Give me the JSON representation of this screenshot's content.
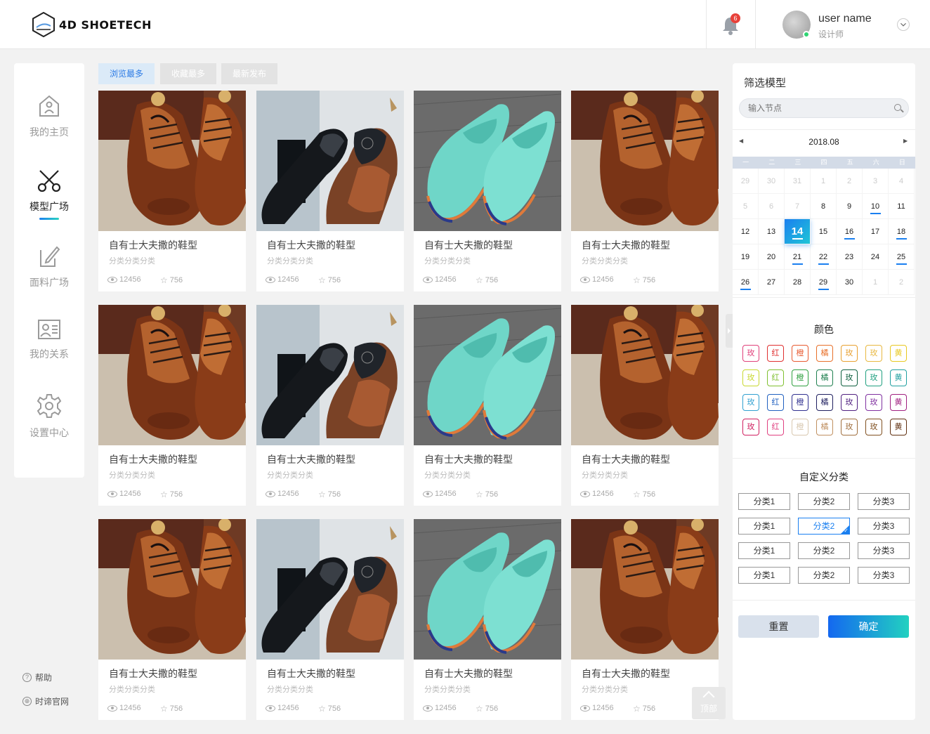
{
  "header": {
    "logo_text": "4D SHOETECH",
    "notification_count": "6",
    "user_name": "user name",
    "user_role": "设计师"
  },
  "nav": {
    "items": [
      {
        "label": "我的主页",
        "icon": "home-icon"
      },
      {
        "label": "模型广场",
        "icon": "scissors-icon"
      },
      {
        "label": "面料广场",
        "icon": "edit-icon"
      },
      {
        "label": "我的关系",
        "icon": "contact-card-icon"
      },
      {
        "label": "设置中心",
        "icon": "gear-icon"
      }
    ],
    "active_index": 1,
    "help": "帮助",
    "official_site": "时谛官网"
  },
  "tabs": [
    "浏览最多",
    "收藏最多",
    "最新发布"
  ],
  "cards": [
    {
      "title": "自有士大夫撒的鞋型",
      "category": "分类分类分类",
      "views": "12456",
      "stars": "756",
      "image": "brown-brogue"
    },
    {
      "title": "自有士大夫撒的鞋型",
      "category": "分类分类分类",
      "views": "12456",
      "stars": "756",
      "image": "black-brown-derby"
    },
    {
      "title": "自有士大夫撒的鞋型",
      "category": "分类分类分类",
      "views": "12456",
      "stars": "756",
      "image": "mint-loafer"
    },
    {
      "title": "自有士大夫撒的鞋型",
      "category": "分类分类分类",
      "views": "12456",
      "stars": "756",
      "image": "brown-brogue"
    },
    {
      "title": "自有士大夫撒的鞋型",
      "category": "分类分类分类",
      "views": "12456",
      "stars": "756",
      "image": "brown-brogue"
    },
    {
      "title": "自有士大夫撒的鞋型",
      "category": "分类分类分类",
      "views": "12456",
      "stars": "756",
      "image": "black-brown-derby"
    },
    {
      "title": "自有士大夫撒的鞋型",
      "category": "分类分类分类",
      "views": "12456",
      "stars": "756",
      "image": "mint-loafer"
    },
    {
      "title": "自有士大夫撒的鞋型",
      "category": "分类分类分类",
      "views": "12456",
      "stars": "756",
      "image": "brown-brogue"
    },
    {
      "title": "自有士大夫撒的鞋型",
      "category": "分类分类分类",
      "views": "12456",
      "stars": "756",
      "image": "brown-brogue"
    },
    {
      "title": "自有士大夫撒的鞋型",
      "category": "分类分类分类",
      "views": "12456",
      "stars": "756",
      "image": "black-brown-derby"
    },
    {
      "title": "自有士大夫撒的鞋型",
      "category": "分类分类分类",
      "views": "12456",
      "stars": "756",
      "image": "mint-loafer"
    },
    {
      "title": "自有士大夫撒的鞋型",
      "category": "分类分类分类",
      "views": "12456",
      "stars": "756",
      "image": "brown-brogue"
    }
  ],
  "back_to_top": "顶部",
  "filter": {
    "title": "筛选模型",
    "search_placeholder": "输入节点",
    "calendar": {
      "month": "2018.08",
      "weekdays": [
        "一",
        "二",
        "三",
        "四",
        "五",
        "六",
        "日"
      ],
      "days": [
        {
          "d": "29",
          "muted": true
        },
        {
          "d": "30",
          "muted": true
        },
        {
          "d": "31",
          "muted": true
        },
        {
          "d": "1",
          "muted": true
        },
        {
          "d": "2",
          "muted": true
        },
        {
          "d": "3",
          "muted": true
        },
        {
          "d": "4",
          "muted": true
        },
        {
          "d": "5",
          "muted": true
        },
        {
          "d": "6",
          "muted": true
        },
        {
          "d": "7",
          "muted": true
        },
        {
          "d": "8"
        },
        {
          "d": "9"
        },
        {
          "d": "10",
          "mark": true
        },
        {
          "d": "11"
        },
        {
          "d": "12"
        },
        {
          "d": "13"
        },
        {
          "d": "14",
          "today": true,
          "mark": true
        },
        {
          "d": "15"
        },
        {
          "d": "16",
          "mark": true
        },
        {
          "d": "17"
        },
        {
          "d": "18",
          "mark": true
        },
        {
          "d": "19"
        },
        {
          "d": "20"
        },
        {
          "d": "21",
          "mark": true
        },
        {
          "d": "22",
          "mark": true
        },
        {
          "d": "23"
        },
        {
          "d": "24"
        },
        {
          "d": "25",
          "mark": true
        },
        {
          "d": "26",
          "mark": true
        },
        {
          "d": "27"
        },
        {
          "d": "28"
        },
        {
          "d": "29",
          "mark": true
        },
        {
          "d": "30"
        },
        {
          "d": "1",
          "muted": true
        },
        {
          "d": "2",
          "muted": true
        }
      ]
    },
    "color_title": "颜色",
    "color_chips": [
      [
        {
          "t": "玫",
          "c": "#e0407a"
        },
        {
          "t": "红",
          "c": "#e03030"
        },
        {
          "t": "橙",
          "c": "#e85a30"
        },
        {
          "t": "橘",
          "c": "#e8702a"
        },
        {
          "t": "玫",
          "c": "#e8a030"
        },
        {
          "t": "玫",
          "c": "#e8b840"
        },
        {
          "t": "黄",
          "c": "#e8c820"
        }
      ],
      [
        {
          "t": "玫",
          "c": "#c8d830"
        },
        {
          "t": "红",
          "c": "#80c030"
        },
        {
          "t": "橙",
          "c": "#30a040"
        },
        {
          "t": "橘",
          "c": "#208050"
        },
        {
          "t": "玫",
          "c": "#106040"
        },
        {
          "t": "玫",
          "c": "#20a080"
        },
        {
          "t": "黄",
          "c": "#20a0a0"
        }
      ],
      [
        {
          "t": "玫",
          "c": "#30a0d0"
        },
        {
          "t": "红",
          "c": "#2060c0"
        },
        {
          "t": "橙",
          "c": "#303090"
        },
        {
          "t": "橘",
          "c": "#202060"
        },
        {
          "t": "玫",
          "c": "#502080"
        },
        {
          "t": "玫",
          "c": "#8030a0"
        },
        {
          "t": "黄",
          "c": "#a02080"
        }
      ],
      [
        {
          "t": "玫",
          "c": "#d02060"
        },
        {
          "t": "红",
          "c": "#e04080"
        },
        {
          "t": "橙",
          "c": "#d8c8b0"
        },
        {
          "t": "橘",
          "c": "#c09060"
        },
        {
          "t": "玫",
          "c": "#a07040"
        },
        {
          "t": "玫",
          "c": "#805020"
        },
        {
          "t": "黄",
          "c": "#603010"
        }
      ]
    ],
    "category_title": "自定义分类",
    "categories": [
      [
        "分类1",
        "分类2",
        "分类3"
      ],
      [
        "分类1",
        "分类2",
        "分类3"
      ],
      [
        "分类1",
        "分类2",
        "分类3"
      ],
      [
        "分类1",
        "分类2",
        "分类3"
      ]
    ],
    "selected_category": {
      "row": 1,
      "col": 1
    },
    "reset_label": "重置",
    "confirm_label": "确定"
  }
}
